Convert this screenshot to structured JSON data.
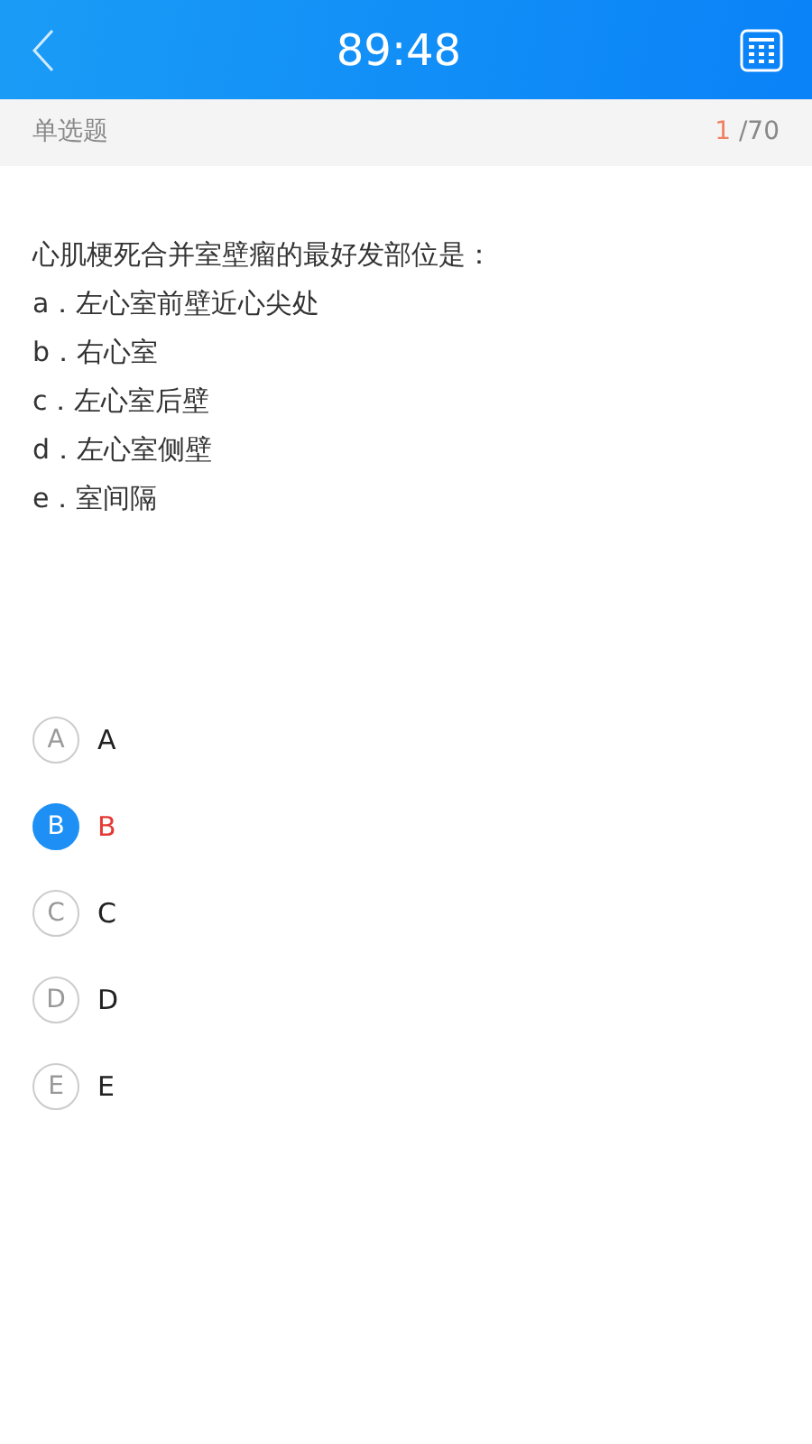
{
  "header": {
    "title": "89:48"
  },
  "question_bar": {
    "type": "单选题",
    "current": "1",
    "total": "/70"
  },
  "question": {
    "stem": "心肌梗死合并室壁瘤的最好发部位是：",
    "choices": [
      "a．左心室前壁近心尖处",
      "b．右心室",
      "c．左心室后壁",
      "d．左心室侧壁",
      "e．室间隔"
    ]
  },
  "answers": [
    {
      "letter": "A",
      "label": "A",
      "selected": false
    },
    {
      "letter": "B",
      "label": "B",
      "selected": true
    },
    {
      "letter": "C",
      "label": "C",
      "selected": false
    },
    {
      "letter": "D",
      "label": "D",
      "selected": false
    },
    {
      "letter": "E",
      "label": "E",
      "selected": false
    }
  ]
}
